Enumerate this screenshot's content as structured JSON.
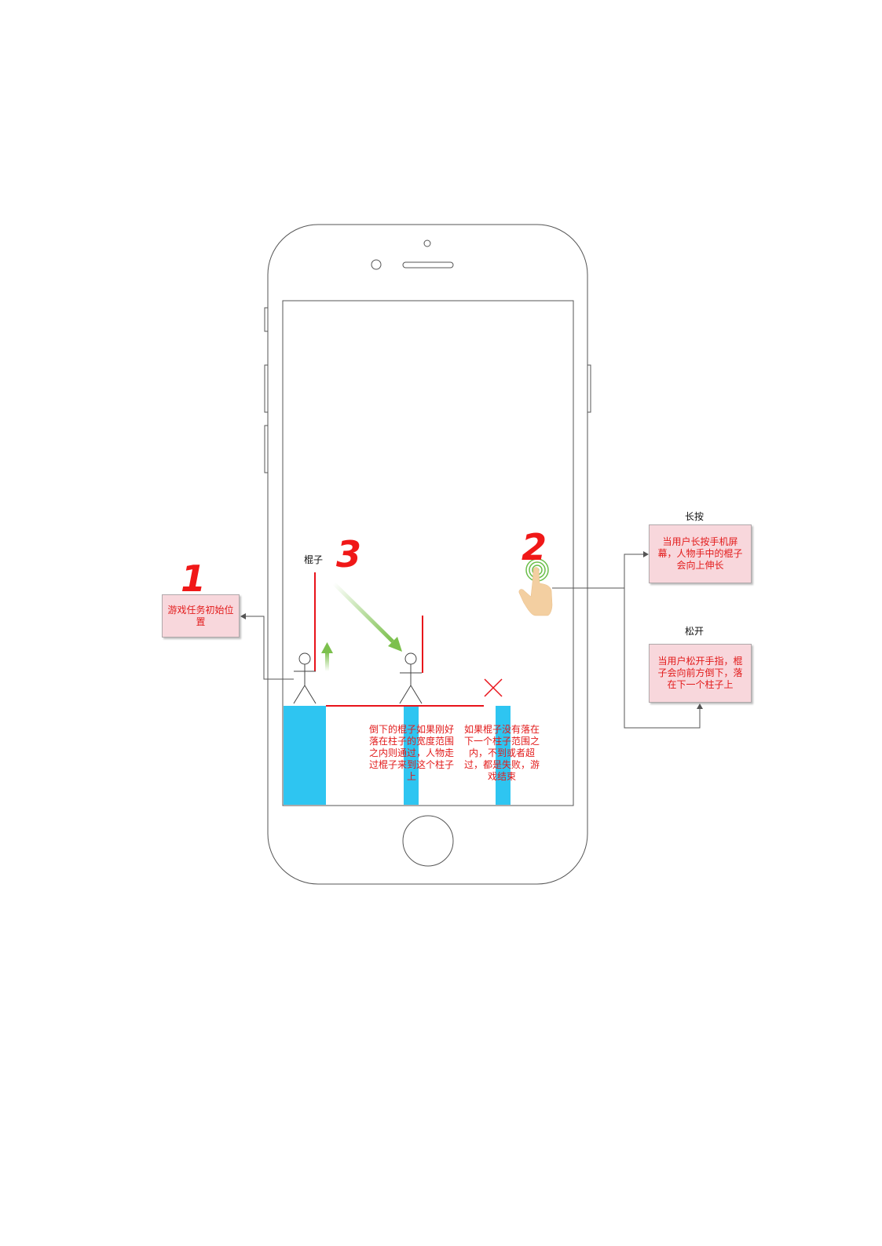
{
  "labels": {
    "stick": "棍子",
    "long_press": "长按",
    "release": "松开"
  },
  "steps": {
    "one": "1",
    "two": "2",
    "three": "3"
  },
  "boxes": {
    "start_position": "游戏任务初始位置",
    "long_press_desc": "当用户长按手机屏幕，人物手中的棍子会向上伸长",
    "release_desc": "当用户松开手指，棍子会向前方倒下，落在下一个柱子上"
  },
  "annotations": {
    "success": "倒下的棍子如果刚好落在柱子的宽度范围之内则通过，人物走过棍子来到这个柱子上",
    "failure": "如果棍子没有落在下一个柱子范围之内，不到或者超过，都是失败，游戏结束"
  },
  "colors": {
    "pillar": "#2ec5f1",
    "stick": "#e8131a",
    "note_fill": "#f8d7dc",
    "note_text": "#e21b1b",
    "arrow_green": "#7cc04d"
  },
  "icons": [
    "stick-figure-icon",
    "up-arrow-icon",
    "green-diagonal-arrow-icon",
    "cross-icon",
    "finger-press-icon"
  ]
}
